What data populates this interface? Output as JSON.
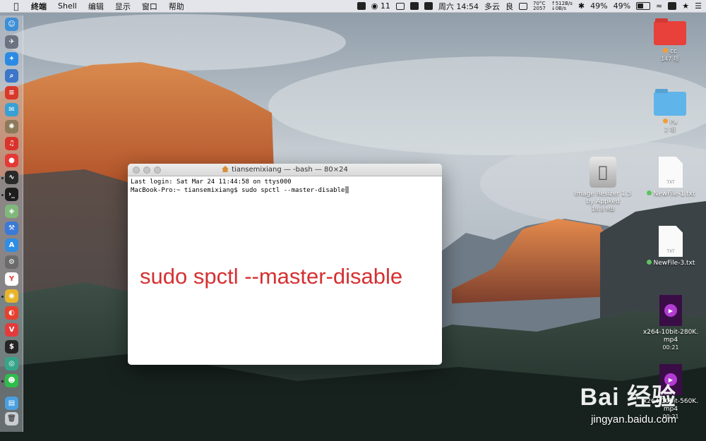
{
  "menubar": {
    "app_name": "终端",
    "menus": [
      "Shell",
      "编辑",
      "显示",
      "窗口",
      "帮助"
    ],
    "wechat_count": "11",
    "clock": "周六 14:54",
    "weather": "多云",
    "air_quality": "良",
    "cpu_temp": "70°C",
    "fan_rpm": "2057",
    "net_up": "↑512B/s",
    "net_down": "↓0B/s",
    "battery_percent_1": "49%",
    "battery_percent_2": "49%"
  },
  "dock": {
    "icons": [
      "finder-icon",
      "launchpad-icon",
      "safari-icon",
      "preview-icon",
      "app-icon",
      "mail-icon",
      "app-icon",
      "app-icon",
      "activity-monitor-icon",
      "terminal-icon",
      "maps-icon",
      "xcode-icon",
      "app-store-icon",
      "system-preferences-icon",
      "yandex-icon",
      "chrome-icon",
      "weibo-icon",
      "vivaldi-icon",
      "console-icon",
      "app-icon",
      "wechat-icon",
      "downloads-folder-icon",
      "trash-icon"
    ]
  },
  "terminal": {
    "title": "tiansemixiang — -bash — 80×24",
    "line1": "Last login: Sat Mar 24 11:44:58 on ttys000",
    "prompt": "MacBook-Pro:~ tiansemixiang$ ",
    "command": "sudo spctl --master-disable",
    "overlay_text": "sudo spctl --master-disable"
  },
  "desktop": {
    "items": [
      {
        "label": "cc",
        "sub": "147 项",
        "kind": "folder",
        "color": "#e8403a",
        "tag_color": "#f29d39"
      },
      {
        "label": "Pa",
        "sub": "2 项",
        "kind": "folder",
        "color": "#5fb4ea",
        "tag_color": "#f29d39"
      },
      {
        "label": "Image Resizer 1.5",
        "label2": "by Appked",
        "sub": "18.8 MB",
        "kind": "app"
      },
      {
        "label": "NewFile-1.txt",
        "kind": "doc",
        "tag_color": "#5cc35c",
        "doc_ext": "TXT"
      },
      {
        "label": "NewFile-3.txt",
        "kind": "doc",
        "tag_color": "#5cc35c",
        "doc_ext": "TXT"
      },
      {
        "label": "x264-10bit-280K.",
        "label2": "mp4",
        "sub": "00:21",
        "kind": "video"
      },
      {
        "label": "x264-10bit-560K.",
        "label2": "mp4",
        "sub": "00:21",
        "kind": "video"
      }
    ]
  },
  "watermark": {
    "brand": "Bai 经验",
    "url": "jingyan.baidu.com"
  }
}
